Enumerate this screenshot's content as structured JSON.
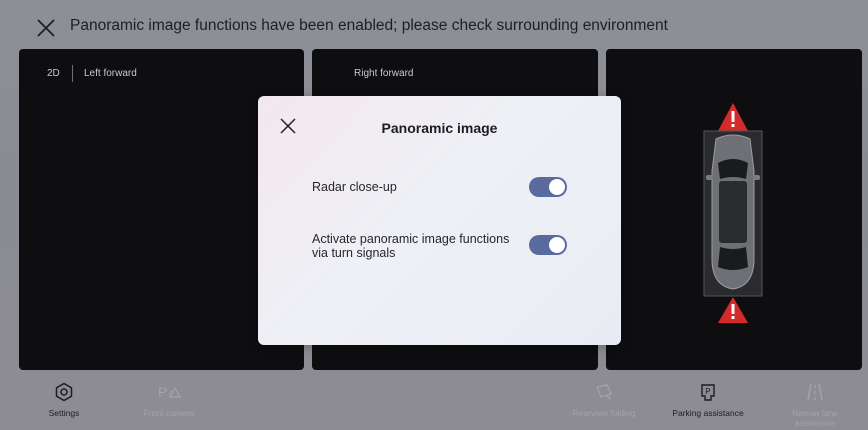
{
  "header": {
    "title": "Panoramic image functions have been enabled; please check surrounding environment",
    "close_icon": "close-icon"
  },
  "views": {
    "mode": "2D",
    "left_label": "Left forward",
    "right_label": "Right forward"
  },
  "modal": {
    "title": "Panoramic image",
    "close_icon": "close-icon",
    "settings": [
      {
        "label": "Radar close-up",
        "enabled": true
      },
      {
        "label": "Activate panoramic image functions via turn signals",
        "enabled": true
      }
    ]
  },
  "bottom_bar": [
    {
      "label": "Settings",
      "icon": "settings-hexagon-icon",
      "state": "active"
    },
    {
      "label": "Front camera",
      "icon": "front-camera-icon",
      "state": "faded"
    },
    {
      "label": "Rearview folding",
      "icon": "rearview-folding-icon",
      "state": "faded"
    },
    {
      "label": "Parking assistance",
      "icon": "parking-assistance-icon",
      "state": "active"
    },
    {
      "label": "Narrow lane assistance",
      "icon": "narrow-lane-icon",
      "state": "faded"
    }
  ],
  "colors": {
    "toggle_on": "#5b6a9e",
    "warning": "#d42a2a",
    "panel_bg": "#0e0e10"
  }
}
